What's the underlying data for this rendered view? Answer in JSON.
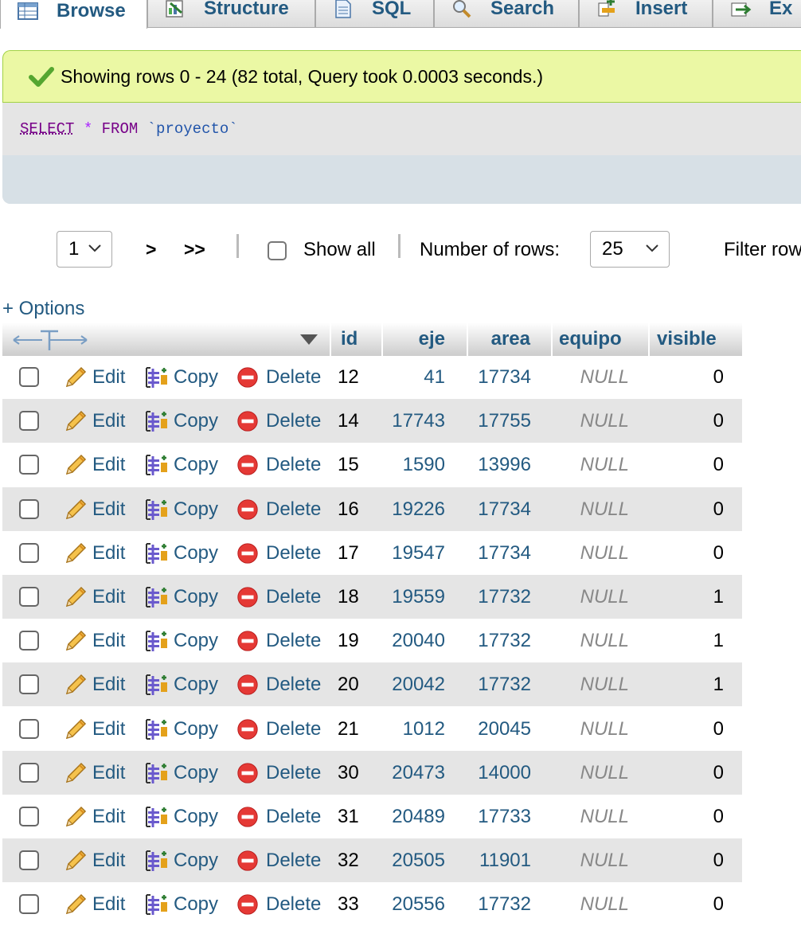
{
  "tabs": [
    {
      "label": "Browse",
      "icon": "table-icon"
    },
    {
      "label": "Structure",
      "icon": "structure-icon"
    },
    {
      "label": "SQL",
      "icon": "sql-icon"
    },
    {
      "label": "Search",
      "icon": "search-icon"
    },
    {
      "label": "Insert",
      "icon": "insert-icon"
    },
    {
      "label": "Ex",
      "icon": "export-icon"
    }
  ],
  "message": "Showing rows 0 - 24 (82 total, Query took 0.0003 seconds.)",
  "sql": {
    "select": "SELECT",
    "star": "*",
    "from": "FROM",
    "table": "`proyecto`"
  },
  "nav": {
    "page": "1",
    "next": ">",
    "last": ">>",
    "show_all": "Show all",
    "rows_label": "Number of rows:",
    "rows_value": "25",
    "filter_label": "Filter rows"
  },
  "options_label": "+ Options",
  "columns": [
    "id",
    "eje",
    "area",
    "equipo",
    "visible"
  ],
  "actions": {
    "edit": "Edit",
    "copy": "Copy",
    "delete": "Delete"
  },
  "rows": [
    {
      "id": "12",
      "eje": "41",
      "area": "17734",
      "equipo": "NULL",
      "visible": "0"
    },
    {
      "id": "14",
      "eje": "17743",
      "area": "17755",
      "equipo": "NULL",
      "visible": "0"
    },
    {
      "id": "15",
      "eje": "1590",
      "area": "13996",
      "equipo": "NULL",
      "visible": "0"
    },
    {
      "id": "16",
      "eje": "19226",
      "area": "17734",
      "equipo": "NULL",
      "visible": "0"
    },
    {
      "id": "17",
      "eje": "19547",
      "area": "17734",
      "equipo": "NULL",
      "visible": "0"
    },
    {
      "id": "18",
      "eje": "19559",
      "area": "17732",
      "equipo": "NULL",
      "visible": "1"
    },
    {
      "id": "19",
      "eje": "20040",
      "area": "17732",
      "equipo": "NULL",
      "visible": "1"
    },
    {
      "id": "20",
      "eje": "20042",
      "area": "17732",
      "equipo": "NULL",
      "visible": "1"
    },
    {
      "id": "21",
      "eje": "1012",
      "area": "20045",
      "equipo": "NULL",
      "visible": "0"
    },
    {
      "id": "30",
      "eje": "20473",
      "area": "14000",
      "equipo": "NULL",
      "visible": "0"
    },
    {
      "id": "31",
      "eje": "20489",
      "area": "17733",
      "equipo": "NULL",
      "visible": "0"
    },
    {
      "id": "32",
      "eje": "20505",
      "area": "11901",
      "equipo": "NULL",
      "visible": "0"
    },
    {
      "id": "33",
      "eje": "20556",
      "area": "17732",
      "equipo": "NULL",
      "visible": "0"
    }
  ]
}
